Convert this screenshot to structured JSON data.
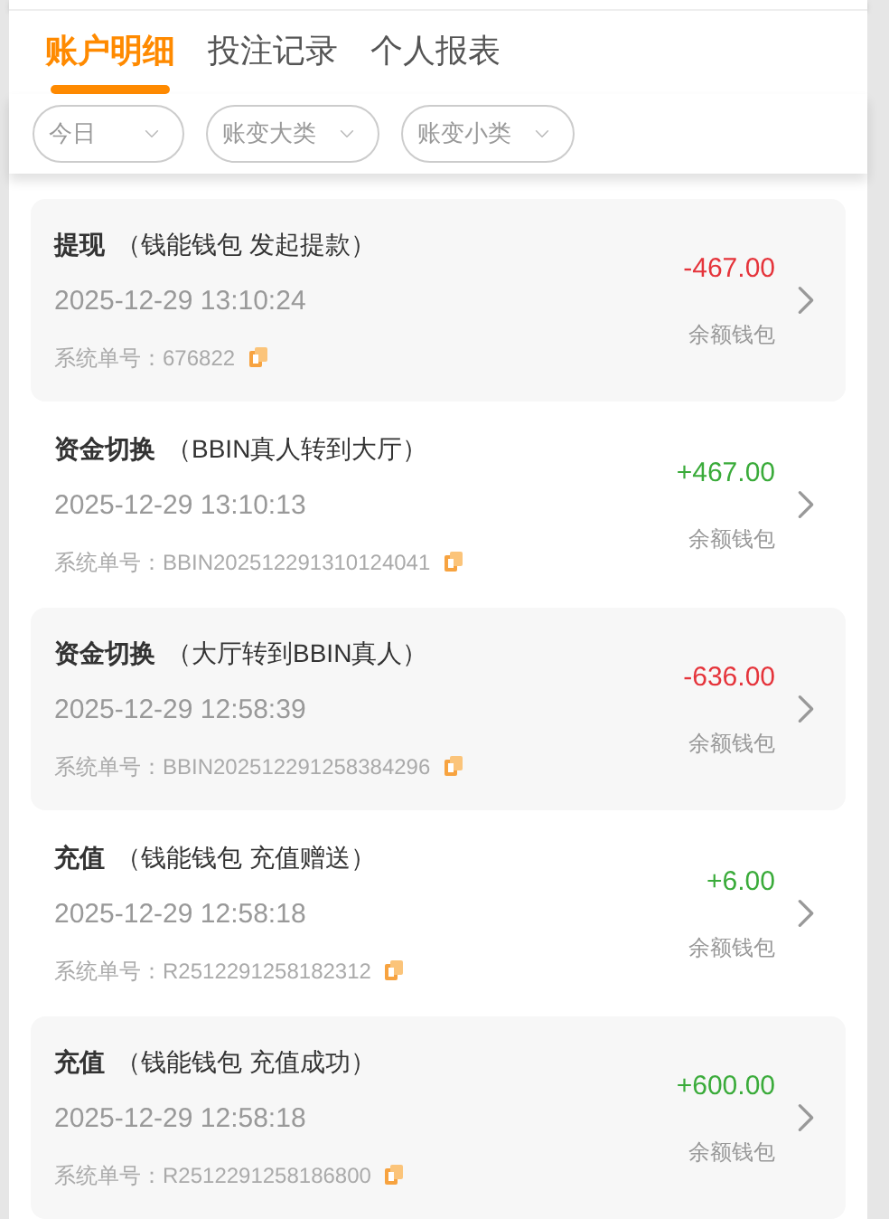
{
  "tabs": [
    {
      "label": "账户明细",
      "selected": true
    },
    {
      "label": "投注记录",
      "selected": false
    },
    {
      "label": "个人报表",
      "selected": false
    }
  ],
  "filters": [
    {
      "label": "今日"
    },
    {
      "label": "账变大类"
    },
    {
      "label": "账变小类"
    }
  ],
  "records": [
    {
      "title": "提现",
      "detail": "（钱能钱包 发起提款）",
      "time": "2025-12-29 13:10:24",
      "order_label": "系统单号：",
      "order_no": "676822",
      "amount": "-467.00",
      "kind": "debit",
      "wallet": "余额钱包"
    },
    {
      "title": "资金切换",
      "detail": "（BBIN真人转到大厅）",
      "time": "2025-12-29 13:10:13",
      "order_label": "系统单号：",
      "order_no": "BBIN202512291310124041",
      "amount": "+467.00",
      "kind": "credit",
      "wallet": "余额钱包"
    },
    {
      "title": "资金切换",
      "detail": "（大厅转到BBIN真人）",
      "time": "2025-12-29 12:58:39",
      "order_label": "系统单号：",
      "order_no": "BBIN202512291258384296",
      "amount": "-636.00",
      "kind": "debit",
      "wallet": "余额钱包"
    },
    {
      "title": "充值",
      "detail": "（钱能钱包 充值赠送）",
      "time": "2025-12-29 12:58:18",
      "order_label": "系统单号：",
      "order_no": "R2512291258182312",
      "amount": "+6.00",
      "kind": "credit",
      "wallet": "余额钱包"
    },
    {
      "title": "充值",
      "detail": "（钱能钱包 充值成功）",
      "time": "2025-12-29 12:58:18",
      "order_label": "系统单号：",
      "order_no": "R2512291258186800",
      "amount": "+600.00",
      "kind": "credit",
      "wallet": "余额钱包"
    }
  ]
}
